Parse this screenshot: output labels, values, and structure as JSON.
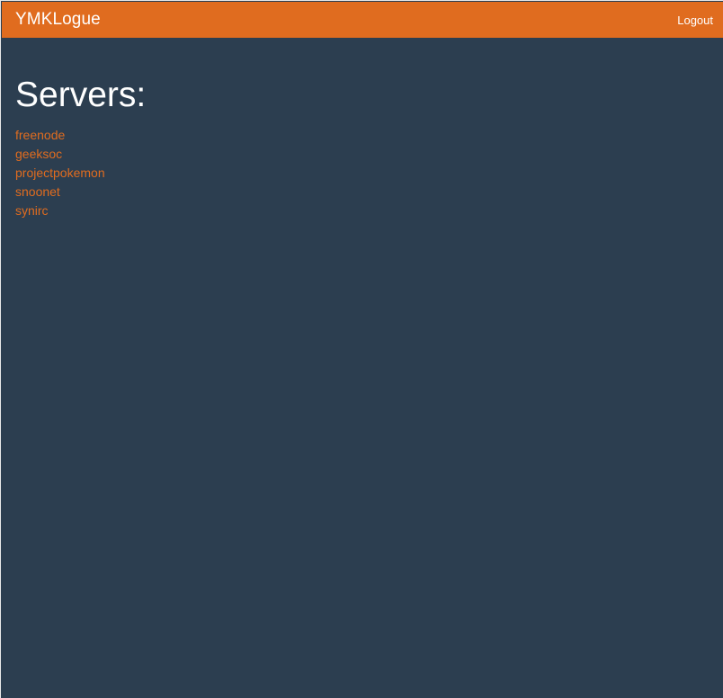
{
  "navbar": {
    "brand": "YMKLogue",
    "logout_label": "Logout"
  },
  "main": {
    "title": "Servers:",
    "servers": [
      {
        "name": "freenode"
      },
      {
        "name": "geeksoc"
      },
      {
        "name": "projectpokemon"
      },
      {
        "name": "snoonet"
      },
      {
        "name": "synirc"
      }
    ]
  },
  "colors": {
    "navbar_bg": "#e06c1f",
    "page_bg": "#2c3e50",
    "link": "#e06c1f",
    "heading": "#ffffff"
  }
}
